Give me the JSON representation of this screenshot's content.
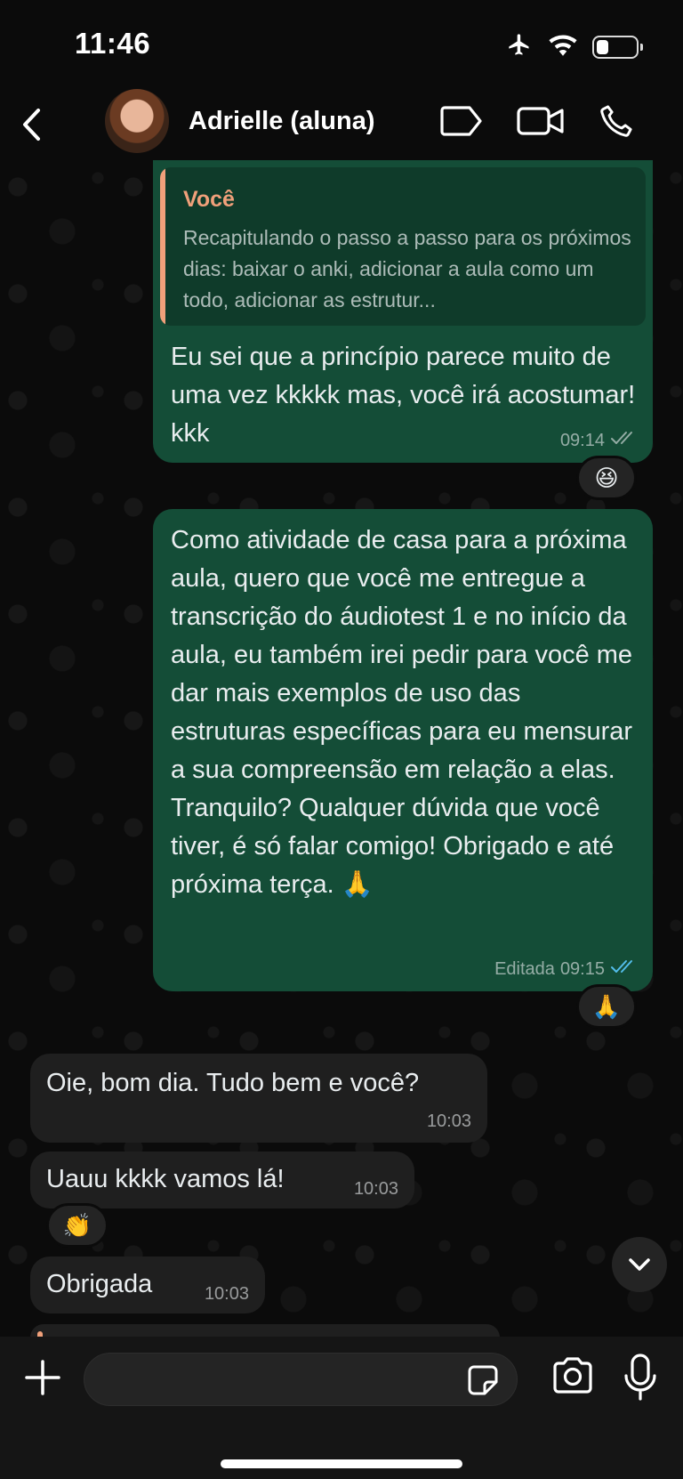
{
  "status_bar": {
    "time": "11:46",
    "battery_level": 0.4
  },
  "header": {
    "contact_name": "Adrielle (aluna)",
    "icons": [
      "back-chevron-icon",
      "label-tag-icon",
      "video-call-icon",
      "phone-call-icon"
    ]
  },
  "messages": [
    {
      "direction": "out",
      "quote": {
        "author": "Você",
        "text": "Recapitulando o passo a passo para os próximos dias: baixar o anki, adicionar a aula como um todo, adicionar as estrutur..."
      },
      "text": "Eu sei que a princípio parece muito de uma vez kkkkk mas, você irá acostumar! kkk",
      "time": "09:14",
      "status": "delivered",
      "reaction": "😆"
    },
    {
      "direction": "out",
      "text": "Como atividade de casa para a próxima aula, quero que você me entregue a transcrição do áudiotest 1 e no início da aula, eu também irei pedir para você me dar mais exemplos de uso das estruturas específicas para eu mensurar a sua compreensão em relação a elas. Tranquilo? Qualquer dúvida que você tiver, é só falar comigo! Obrigado e até próxima terça. 🙏",
      "edited_label": "Editada",
      "time": "09:15",
      "status": "read",
      "reaction": "🙏"
    },
    {
      "direction": "in",
      "text": "Oie, bom dia. Tudo bem e você?",
      "time": "10:03"
    },
    {
      "direction": "in",
      "text": "Uauu kkkk vamos lá!",
      "time": "10:03",
      "reaction": "👏"
    },
    {
      "direction": "in",
      "text": "Obrigada",
      "time": "10:03"
    }
  ],
  "composer": {
    "icons": [
      "plus-icon",
      "sticker-icon",
      "camera-icon",
      "microphone-icon"
    ]
  },
  "colors": {
    "outgoing_bubble": "#144d37",
    "incoming_bubble": "#1f1f1f",
    "quote_accent": "#f0a07a",
    "read_ticks": "#53bdeb"
  }
}
